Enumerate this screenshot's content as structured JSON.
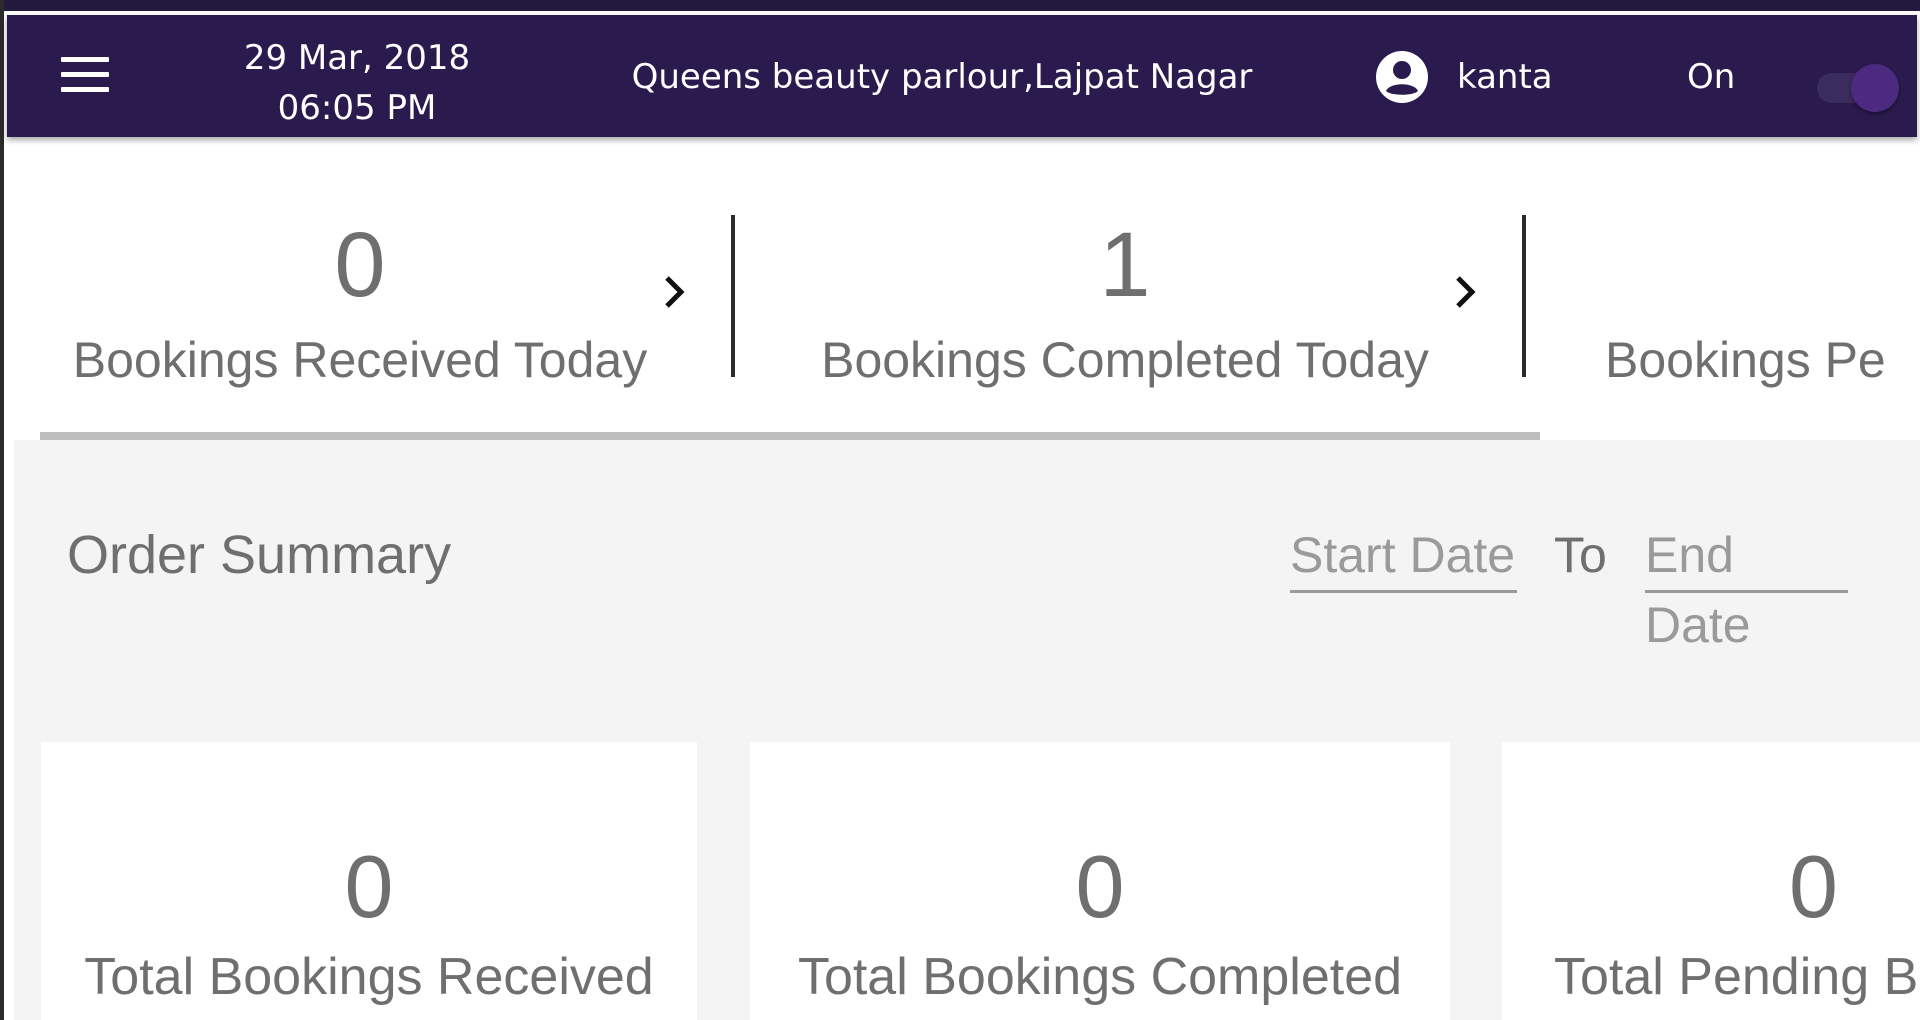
{
  "appbar": {
    "date": "29 Mar, 2018",
    "time": "06:05 PM",
    "shop_name": "Queens beauty parlour,Lajpat Nagar",
    "username": "kanta",
    "status_text": "On",
    "toggle_on": true,
    "bg_color": "#2a1a4e"
  },
  "stats": [
    {
      "value": "0",
      "label": "Bookings Received Today"
    },
    {
      "value": "1",
      "label": "Bookings Completed Today"
    },
    {
      "value": "",
      "label": "Bookings Pe"
    }
  ],
  "summary": {
    "title": "Order Summary",
    "start_placeholder": "Start Date",
    "to_label": "To",
    "end_placeholder": "End Date"
  },
  "cards": [
    {
      "value": "0",
      "label": "Total Bookings Received"
    },
    {
      "value": "0",
      "label": "Total Bookings Completed"
    },
    {
      "value": "0",
      "label": "Total Pending B"
    }
  ],
  "icons": {
    "menu": "menu-icon",
    "user": "account-circle-icon",
    "chevron": "chevron-right-icon"
  }
}
